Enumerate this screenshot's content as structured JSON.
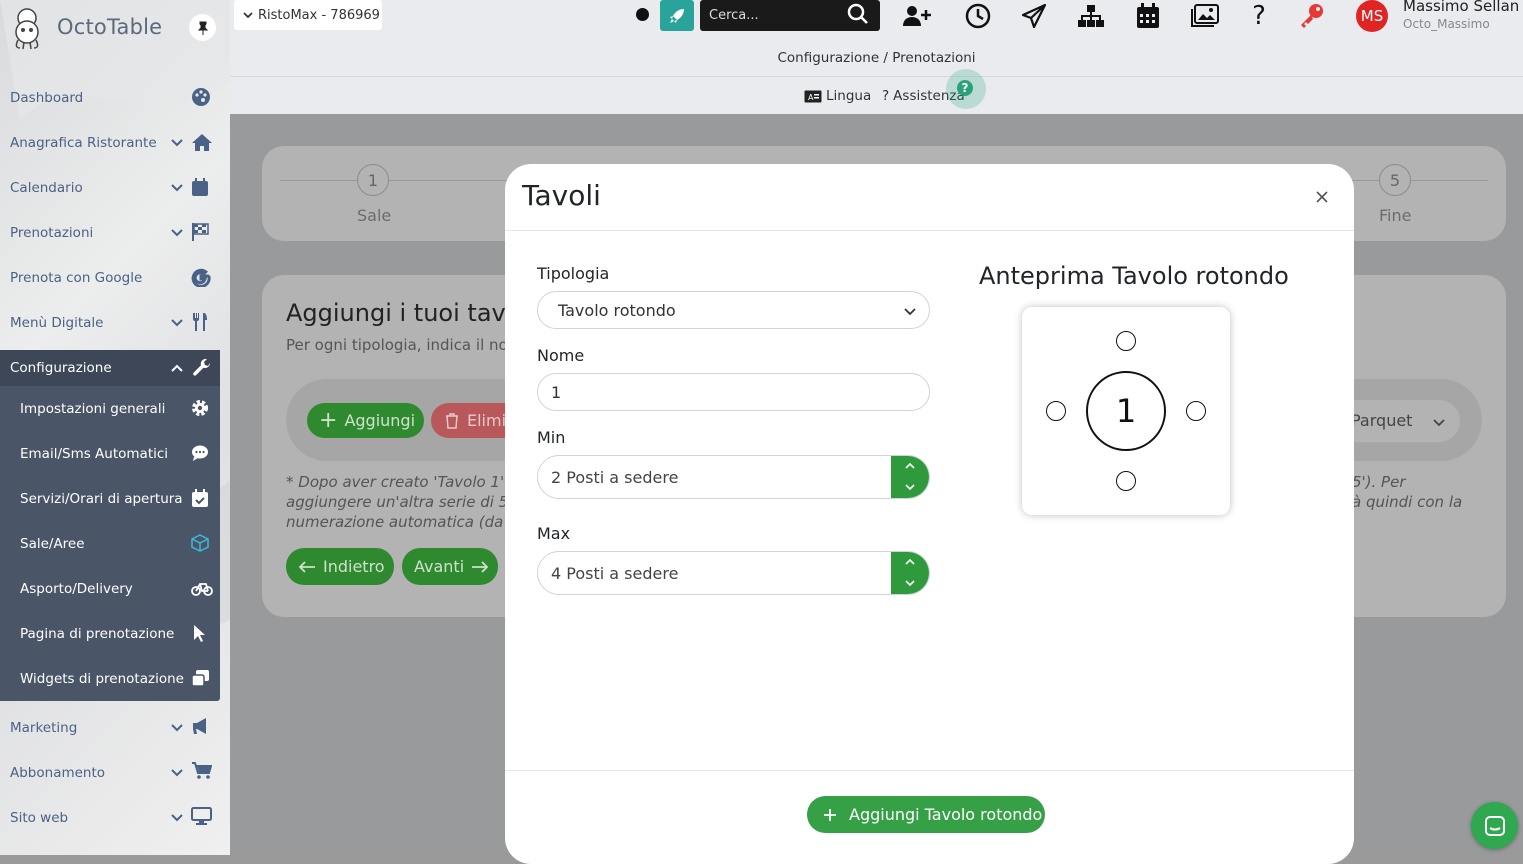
{
  "app": {
    "name": "OctoTable"
  },
  "sidebar": {
    "items": [
      {
        "label": "Dashboard",
        "icon": "palette-icon"
      },
      {
        "label": "Anagrafica Ristorante",
        "icon": "home-icon"
      },
      {
        "label": "Calendario",
        "icon": "calendar-icon"
      },
      {
        "label": "Prenotazioni",
        "icon": "flag-checkered-icon"
      },
      {
        "label": "Prenota con Google",
        "icon": "google-icon"
      },
      {
        "label": "Menù Digitale",
        "icon": "utensils-icon"
      }
    ],
    "config": {
      "label": "Configurazione",
      "subitems": [
        {
          "label": "Impostazioni generali",
          "icon": "gear-icon"
        },
        {
          "label": "Email/Sms Automatici",
          "icon": "chat-icon"
        },
        {
          "label": "Servizi/Orari di apertura",
          "icon": "calendar-check-icon"
        },
        {
          "label": "Sale/Aree",
          "icon": "cube-icon"
        },
        {
          "label": "Asporto/Delivery",
          "icon": "bicycle-icon"
        },
        {
          "label": "Pagina di prenotazione",
          "icon": "cursor-icon"
        },
        {
          "label": "Widgets di prenotazione",
          "icon": "widgets-icon"
        }
      ]
    },
    "bottom_items": [
      {
        "label": "Marketing",
        "icon": "megaphone-icon"
      },
      {
        "label": "Abbonamento",
        "icon": "cart-icon"
      },
      {
        "label": "Sito web",
        "icon": "monitor-icon"
      }
    ]
  },
  "topbar": {
    "restaurant_select": "RistoMax - 786969",
    "search_placeholder": "Cerca...",
    "user": {
      "initials": "MS",
      "name": "Massimo Sellan",
      "handle": "Octo_Massimo"
    }
  },
  "breadcrumb": "Configurazione / Prenotazioni",
  "helpbar": {
    "lingua": "Lingua",
    "assistenza": "Assistenza",
    "help_badge": "?"
  },
  "background": {
    "steps": [
      {
        "number": "1",
        "label": "Sale"
      },
      {
        "number": "5",
        "label": "Fine"
      }
    ],
    "heading": "Aggiungi i tuoi tavol",
    "subheading": "Per ogni tipologia, indica il no",
    "btn_add": "Aggiungi",
    "btn_delete": "Elimi",
    "area_select": "Parquet",
    "note_left_1": "* Dopo aver creato 'Tavolo 1'",
    "note_left_2": "aggiungere un'altra serie di 5",
    "note_left_3": "numerazione automatica (da",
    "note_right_1": "5'). Per",
    "note_right_2": "à quindi con la",
    "btn_back": "Indietro",
    "btn_next": "Avanti"
  },
  "modal": {
    "title": "Tavoli",
    "fields": {
      "tipologia_label": "Tipologia",
      "tipologia_value": "Tavolo rotondo",
      "nome_label": "Nome",
      "nome_value": "1",
      "min_label": "Min",
      "min_value": "2 Posti a sedere",
      "max_label": "Max",
      "max_value": "4 Posti a sedere"
    },
    "preview_title": "Anteprima Tavolo rotondo",
    "preview_table_number": "1",
    "submit": "Aggiungi Tavolo rotondo"
  },
  "colors": {
    "accent_green": "#35a046",
    "teal": "#2aa39a",
    "avatar_red": "#e02424",
    "sidebar_active": "#4a5568"
  }
}
